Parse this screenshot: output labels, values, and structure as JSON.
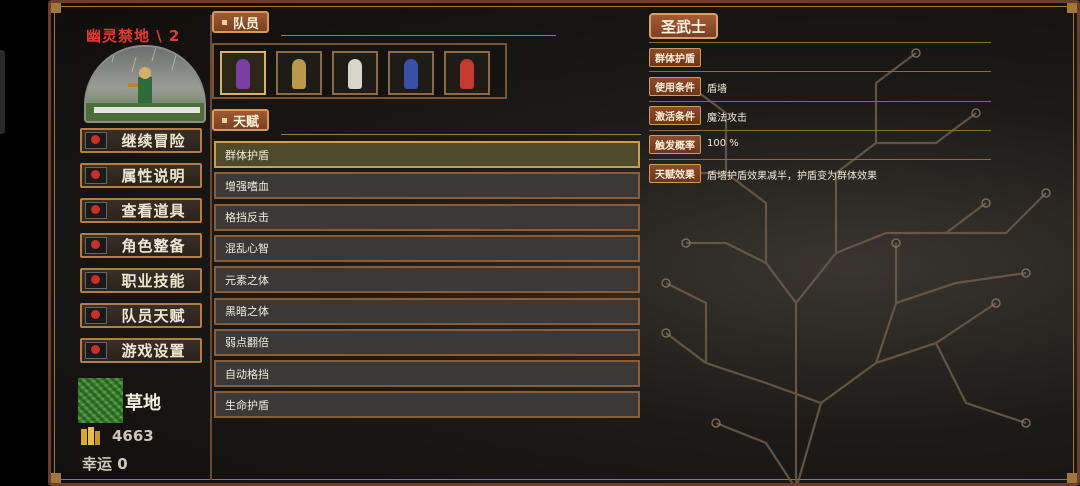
{
  "location": {
    "title": "幽灵禁地 \\ 2"
  },
  "menu": [
    {
      "label": "继续冒险"
    },
    {
      "label": "属性说明"
    },
    {
      "label": "查看道具"
    },
    {
      "label": "角色整备"
    },
    {
      "label": "职业技能"
    },
    {
      "label": "队员天赋"
    },
    {
      "label": "游戏设置"
    }
  ],
  "status": {
    "terrain": "草地",
    "gold": "4663",
    "luck": "幸运 0"
  },
  "team": {
    "label": "队员",
    "members": [
      {
        "color": "#7a3fa0",
        "selected": true
      },
      {
        "color": "#b89a4a",
        "selected": false
      },
      {
        "color": "#d8d4c8",
        "selected": false
      },
      {
        "color": "#3a4fa8",
        "selected": false
      },
      {
        "color": "#c43a2e",
        "selected": false
      }
    ]
  },
  "talents": {
    "label": "天赋",
    "items": [
      "群体护盾",
      "增强嗜血",
      "格挡反击",
      "混乱心智",
      "元素之体",
      "黑暗之体",
      "弱点翻倍",
      "自动格挡",
      "生命护盾"
    ],
    "selected_index": 0
  },
  "detail": {
    "class_name": "圣武士",
    "talent_name": "群体护盾",
    "fields": [
      {
        "key": "使用条件",
        "value": "盾墙"
      },
      {
        "key": "激活条件",
        "value": "魔法攻击"
      },
      {
        "key": "触发概率",
        "value": "100 %"
      },
      {
        "key": "天赋效果",
        "value": "盾墙护盾效果减半，护盾变为群体效果"
      }
    ]
  },
  "colors": {
    "accent": "#b07f48",
    "location_title": "#e33b30",
    "panel_row": "#3a3938"
  }
}
